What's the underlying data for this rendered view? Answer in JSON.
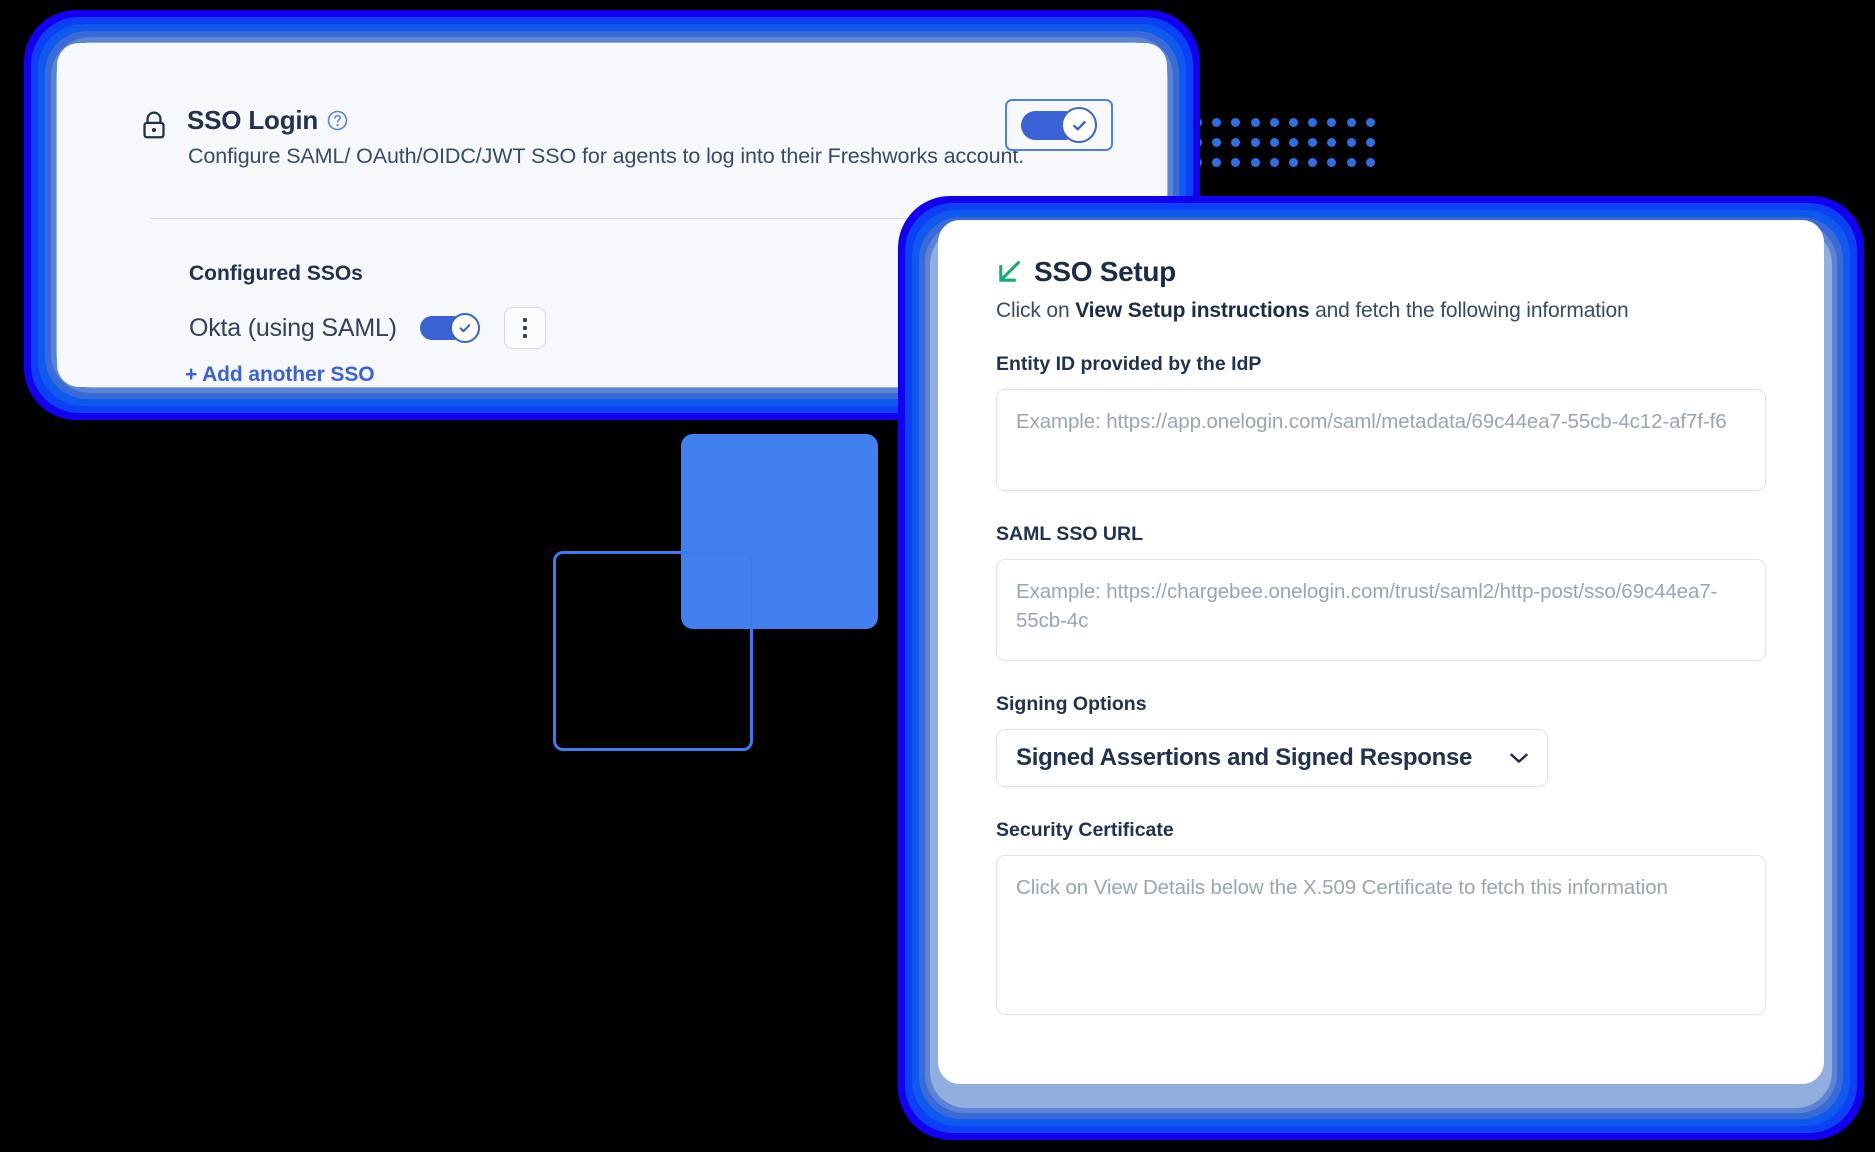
{
  "colors": {
    "glow_outer": "#1400f0",
    "glow_mid": "#0b40f5",
    "accent_blue": "#3a62d4",
    "arrow_green": "#16a77f",
    "title_navy": "#22314f",
    "placeholder_gray": "#9aa5b4",
    "deco_square": "#4180ef"
  },
  "left_card": {
    "lock_icon": "lock-icon",
    "title": "SSO Login",
    "help_icon": "help-circle-icon",
    "subtitle": "Configure SAML/ OAuth/OIDC/JWT SSO for agents to log into their Freshworks account.",
    "master_toggle": {
      "name": "sso-login-toggle",
      "state": "on",
      "knob_icon": "check-icon"
    },
    "section_title": "Configured SSOs",
    "sso_list": [
      {
        "name": "Okta (using SAML)",
        "toggle_state": "on",
        "toggle_knob_icon": "check-icon",
        "menu_icon": "kebab-menu-icon"
      }
    ],
    "add_link": "+ Add another SSO"
  },
  "right_card": {
    "arrow_icon": "arrow-down-left-icon",
    "title": "SSO Setup",
    "subtitle_pre": "Click on ",
    "subtitle_bold": "View Setup instructions",
    "subtitle_post": " and fetch the following information",
    "fields": [
      {
        "label": "Entity ID provided by the IdP",
        "placeholder": "Example: https://app.onelogin.com/saml/metadata/69c44ea7-55cb-4c12-af7f-f6",
        "value": ""
      },
      {
        "label": "SAML SSO URL",
        "placeholder": "Example: https://chargebee.onelogin.com/trust/saml2/http-post/sso/69c44ea7-55cb-4c",
        "value": ""
      }
    ],
    "signing": {
      "label": "Signing Options",
      "selected": "Signed Assertions and Signed Response",
      "chevron_icon": "chevron-down-icon"
    },
    "certificate": {
      "label": "Security Certificate",
      "placeholder": "Click on View Details below the X.509 Certificate to fetch this information",
      "value": ""
    }
  },
  "decorations": {
    "dot_grid": {
      "name": "dot-grid-decoration",
      "rows": 3,
      "cols": 10
    },
    "filled_square": "filled-square-decoration",
    "outline_square": "outline-square-decoration"
  }
}
